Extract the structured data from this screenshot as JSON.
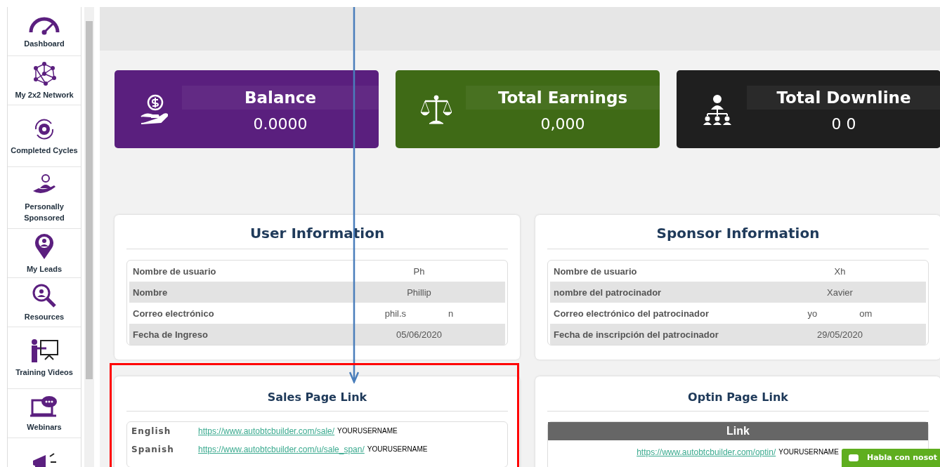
{
  "sidebar": {
    "items": [
      {
        "kind": "labeled",
        "label": "Dashboard"
      },
      {
        "kind": "labeled",
        "label": "My 2x2 Network"
      },
      {
        "kind": "labeled",
        "label": "Completed Cycles"
      },
      {
        "kind": "labeled",
        "label": "Personally Sponsored"
      },
      {
        "kind": "labeled",
        "label": "My Leads"
      },
      {
        "kind": "labeled",
        "label": "Resources"
      },
      {
        "kind": "labeled",
        "label": "Training Videos"
      },
      {
        "kind": "labeled",
        "label": "Webinars"
      },
      {
        "kind": "icon"
      }
    ]
  },
  "stats": [
    {
      "title": "Balance",
      "value": "0.0000",
      "color": "#5a1f7e"
    },
    {
      "title": "Total Earnings",
      "value": "0,000",
      "color": "#3f6a16"
    },
    {
      "title": "Total Downline",
      "value": "0 0",
      "color": "#1f1f1f"
    }
  ],
  "user_information": {
    "title": "User Information",
    "rows": [
      {
        "label": "Nombre de usuario",
        "value": [
          "Ph"
        ]
      },
      {
        "label": "Nombre",
        "value": [
          "Phillip"
        ]
      },
      {
        "label": "Correo electrónico",
        "value": [
          "phil.s",
          "n"
        ]
      },
      {
        "label": "Fecha de Ingreso",
        "value": [
          "05/06/2020"
        ]
      }
    ]
  },
  "sponsor_information": {
    "title": "Sponsor Information",
    "rows": [
      {
        "label": "Nombre de usuario",
        "value": [
          "Xh"
        ]
      },
      {
        "label": "nombre del patrocinador",
        "value": [
          "Xavier"
        ]
      },
      {
        "label": "Correo electrónico del patrocinador",
        "value": [
          "yo",
          "om"
        ]
      },
      {
        "label": "Fecha de inscripción del patrocinador",
        "value": [
          "29/05/2020"
        ]
      }
    ]
  },
  "sales_page_link": {
    "title": "Sales Page Link",
    "links": [
      {
        "language": "English",
        "url": "https://www.autobtcbuilder.com/sale/",
        "suffix": "YOURUSERNAME"
      },
      {
        "language": "Spanish",
        "url": "https://www.autobtcbuilder.com/u/sale_span/",
        "suffix": "YOURUSERNAME"
      }
    ]
  },
  "optin_page_link": {
    "title": "Optin Page Link",
    "header": "Link",
    "links": [
      {
        "url": "https://www.autobtcbuilder.com/optin/",
        "suffix": "YOURUSERNAME"
      }
    ]
  },
  "chat_widget": {
    "label": "Habla con nosot"
  }
}
